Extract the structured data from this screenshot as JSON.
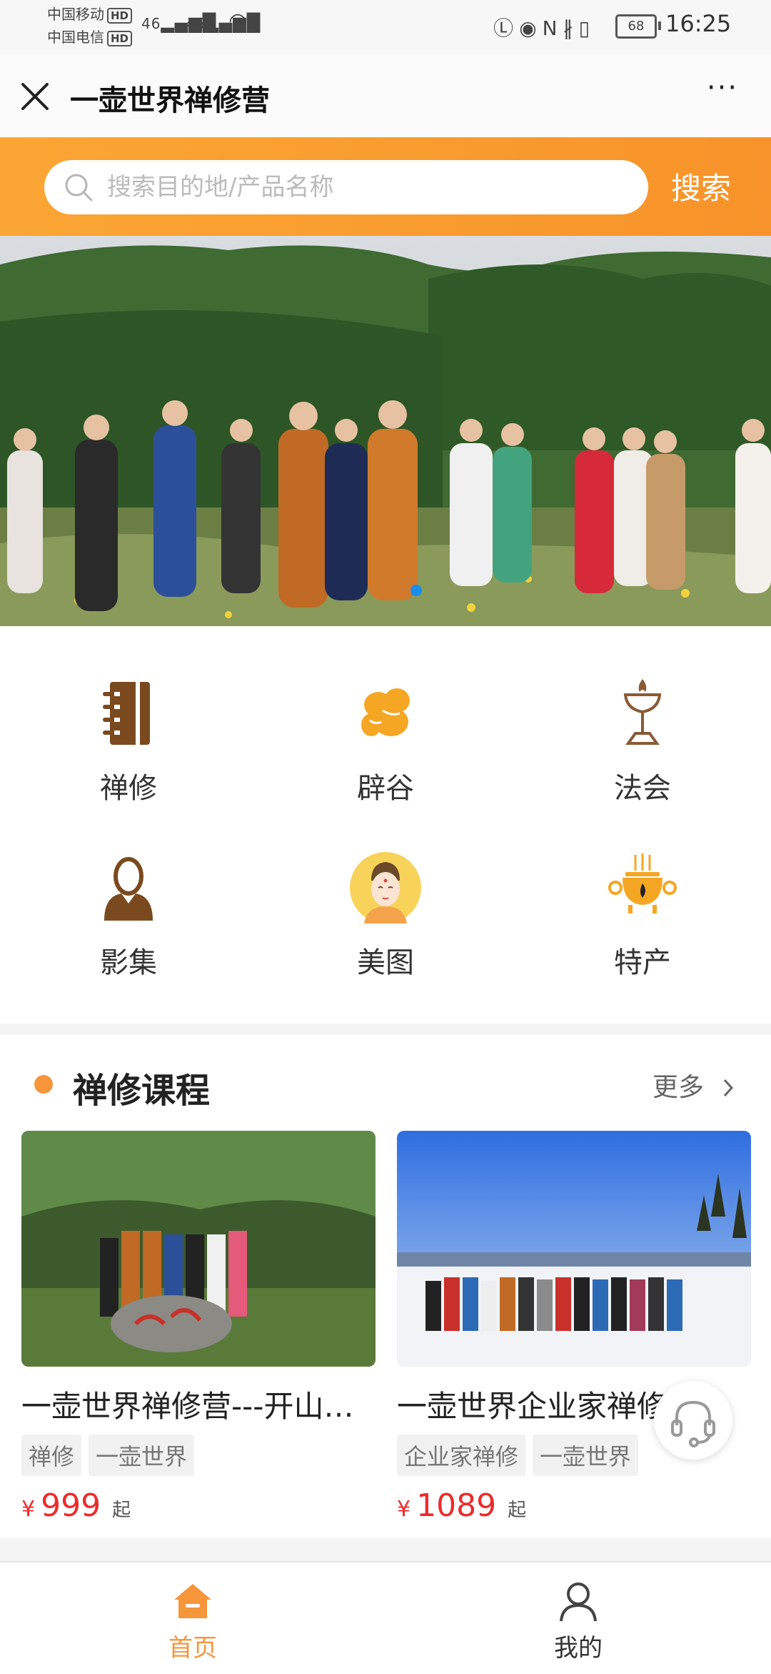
{
  "status_bar": {
    "carrier1": "中国移动",
    "carrier2": "中国电信",
    "hd": "HD",
    "signal1": "46",
    "signal2": "46",
    "battery": "68",
    "time": "16:25"
  },
  "nav": {
    "title": "一壶世界禅修营",
    "more_label": "···"
  },
  "search": {
    "placeholder": "搜索目的地/产品名称",
    "value": "",
    "button_label": "搜索"
  },
  "categories": [
    {
      "label": "禅修",
      "icon": "notebook-icon",
      "color": "#7a4a1e"
    },
    {
      "label": "辟谷",
      "icon": "grain-icon",
      "color": "#f5a623"
    },
    {
      "label": "法会",
      "icon": "incense-lamp-icon",
      "color": "#8a5a35"
    },
    {
      "label": "影集",
      "icon": "monk-icon",
      "color": "#7a4a1e"
    },
    {
      "label": "美图",
      "icon": "buddha-face-icon",
      "color": "#f7d35a"
    },
    {
      "label": "特产",
      "icon": "censer-icon",
      "color": "#f5a623"
    }
  ],
  "section": {
    "title": "禅修课程",
    "more_label": "更多"
  },
  "courses": [
    {
      "title": "一壶世界禅修营---开山…",
      "tags": [
        "禅修",
        "一壶世界"
      ],
      "currency": "¥",
      "price": "999",
      "price_suffix": "起"
    },
    {
      "title": "一壶世界企业家禅修",
      "tags": [
        "企业家禅修",
        "一壶世界"
      ],
      "currency": "¥",
      "price": "1089",
      "price_suffix": "起"
    }
  ],
  "tabbar": {
    "home_label": "首页",
    "me_label": "我的"
  },
  "colors": {
    "accent": "#f6953a",
    "search_band": "#f89c30",
    "price": "#ee2a2a",
    "banner_dot": "#1a8ef0"
  }
}
